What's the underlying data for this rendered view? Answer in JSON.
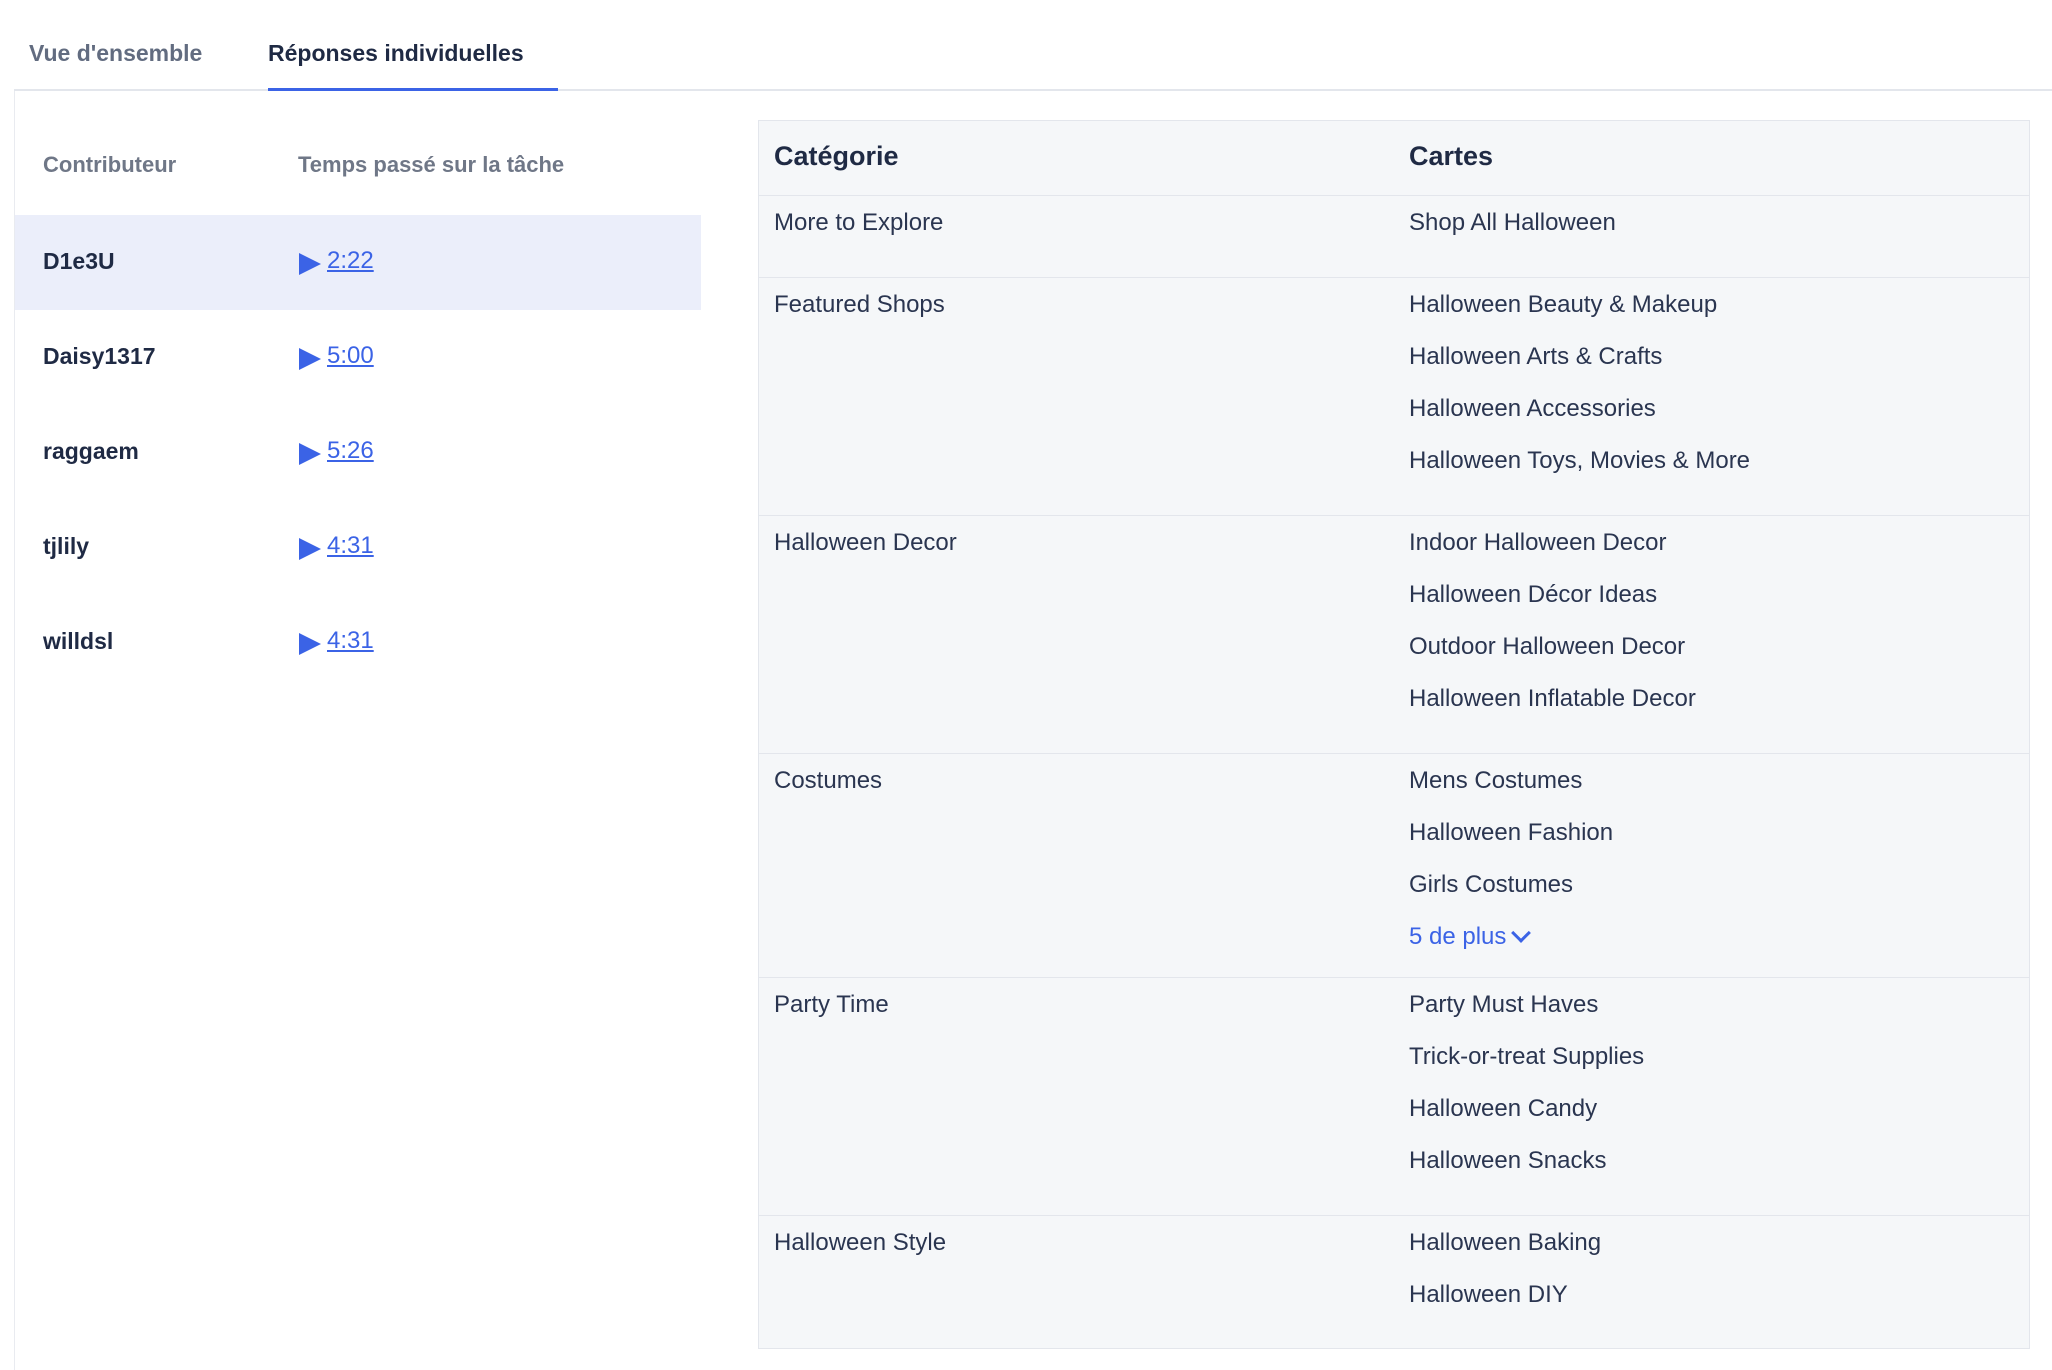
{
  "tabs": {
    "overview": "Vue d'ensemble",
    "individual": "Réponses individuelles"
  },
  "contributors": {
    "header_name": "Contributeur",
    "header_time": "Temps passé sur la tâche",
    "rows": [
      {
        "name": "D1e3U",
        "time": "2:22",
        "selected": true
      },
      {
        "name": "Daisy1317",
        "time": "5:00",
        "selected": false
      },
      {
        "name": "raggaem",
        "time": "5:26",
        "selected": false
      },
      {
        "name": "tjlily",
        "time": "4:31",
        "selected": false
      },
      {
        "name": "willdsl",
        "time": "4:31",
        "selected": false
      }
    ]
  },
  "table": {
    "header_category": "Catégorie",
    "header_cards": "Cartes",
    "rows": [
      {
        "category": "More to Explore",
        "cards": [
          "Shop All Halloween"
        ]
      },
      {
        "category": "Featured Shops",
        "cards": [
          "Halloween Beauty & Makeup",
          "Halloween Arts & Crafts",
          "Halloween Accessories",
          "Halloween Toys, Movies & More"
        ]
      },
      {
        "category": "Halloween Decor",
        "cards": [
          "Indoor Halloween Decor",
          "Halloween Décor Ideas",
          "Outdoor Halloween Decor",
          "Halloween Inflatable Decor"
        ]
      },
      {
        "category": "Costumes",
        "cards": [
          "Mens Costumes",
          "Halloween Fashion",
          "Girls Costumes"
        ],
        "more": "5 de plus"
      },
      {
        "category": "Party Time",
        "cards": [
          "Party Must Haves",
          "Trick-or-treat Supplies",
          "Halloween Candy",
          "Halloween Snacks"
        ]
      },
      {
        "category": "Halloween Style",
        "cards": [
          "Halloween Baking",
          "Halloween DIY"
        ]
      }
    ]
  },
  "colors": {
    "accent": "#3b63e6",
    "selected_row": "#ebeefa",
    "table_bg": "#f5f7f9"
  }
}
